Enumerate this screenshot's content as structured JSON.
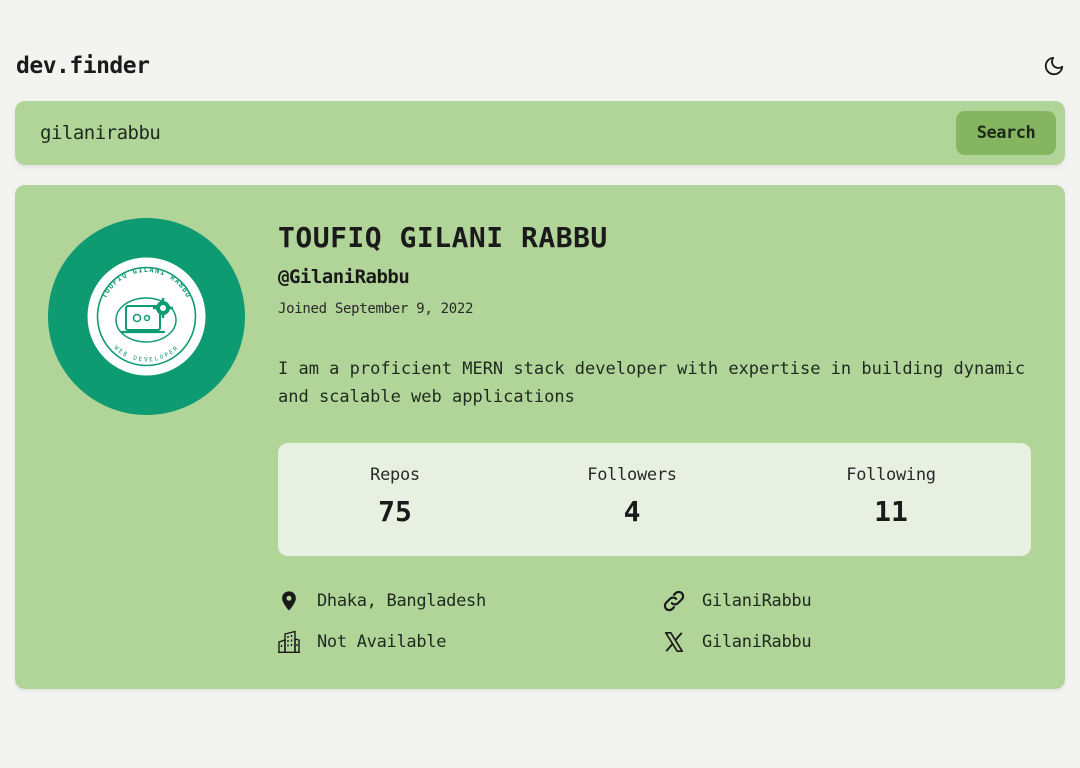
{
  "app": {
    "logo": "dev.finder"
  },
  "header": {
    "theme_icon": "moon-icon"
  },
  "search": {
    "value": "gilanirabbu",
    "button_label": "Search"
  },
  "profile": {
    "avatar_text_top": "TOUFIQ GILANI RABBU",
    "avatar_text_bottom": "WEB DEVELOPER",
    "name": "TOUFIQ GILANI RABBU",
    "handle": "@GilaniRabbu",
    "joined": "Joined September 9, 2022",
    "bio": "I am a proficient MERN stack developer with expertise in building dynamic and scalable web applications",
    "stats": [
      {
        "label": "Repos",
        "value": "75"
      },
      {
        "label": "Followers",
        "value": "4"
      },
      {
        "label": "Following",
        "value": "11"
      }
    ],
    "location": "Dhaka, Bangladesh",
    "company": "Not Available",
    "blog": "GilaniRabbu",
    "twitter": "GilaniRabbu"
  },
  "colors": {
    "background": "#f3f4f2",
    "card": "#b1d498",
    "button": "#86b562",
    "stats_panel": "#e8f0e2",
    "avatar_bg": "#0e9b72"
  }
}
